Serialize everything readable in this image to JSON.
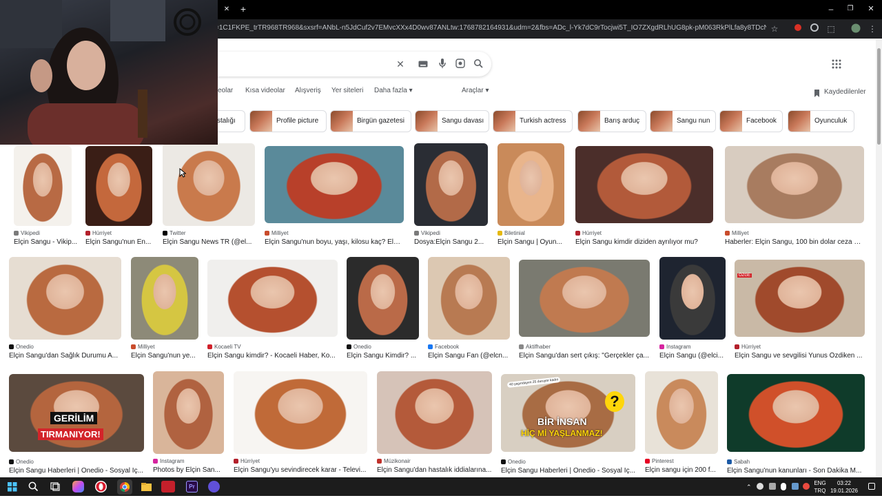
{
  "browser": {
    "close_tab_glyph": "✕",
    "new_tab_glyph": "+",
    "url": "=1C1FKPE_trTR968TR968&sxsrf=ANbL-n5JdCuf2v7EMvcXXx4D0wv87ANLtw:1768782164931&udm=2&fbs=ADc_l-Yk7dC9rTocjwi5T_IO7ZXgdRLhUG8pk-pM063RkPlLfa8y8TDcNYX0oihjHX-_g..."
  },
  "search_nav": {
    "tabs": [
      "eolar",
      "Kısa videolar",
      "Alışveriş",
      "Yer siteleri",
      "Daha fazla ▾",
      "Araçlar ▾"
    ],
    "saved_label": "Kaydedilenler"
  },
  "chips": [
    "stalığı",
    "Profile picture",
    "Birgün gazetesi",
    "Sangu davası",
    "Turkish actress",
    "Barış arduç",
    "Sangu nun",
    "Facebook",
    "Oyunculuk"
  ],
  "results": [
    {
      "source": "Vikipedi",
      "title": "Elçin Sangu - Vikip...",
      "color": "#7a7a7a"
    },
    {
      "source": "Hürriyet",
      "title": "Elçin Sangu'nun En...",
      "color": "#b3202b"
    },
    {
      "source": "Twitter",
      "title": "Elçin Sangu News TR (@el...",
      "color": "#000000"
    },
    {
      "source": "Milliyet",
      "title": "Elçin Sangu'nun boyu, yaşı, kilosu kaç? Elçi...",
      "color": "#c94c2c"
    },
    {
      "source": "Vikipedi",
      "title": "Dosya:Elçin Sangu 2...",
      "color": "#7a7a7a"
    },
    {
      "source": "Biletinial",
      "title": "Elçin Sangu | Oyun...",
      "color": "#e5b810"
    },
    {
      "source": "Hürriyet",
      "title": "Elçin Sangu kimdir diziden ayrılıyor mu?",
      "color": "#b3202b"
    },
    {
      "source": "Milliyet",
      "title": "Haberler: Elçin Sangu, 100 bin dolar ceza ve...",
      "color": "#c94c2c"
    },
    {
      "source": "Onedio",
      "title": "Elçin Sangu'dan Sağlık Durumu A...",
      "color": "#111111"
    },
    {
      "source": "Milliyet",
      "title": "Elçin Sangu'nun ye...",
      "color": "#c94c2c"
    },
    {
      "source": "Kocaeli TV",
      "title": "Elçin Sangu kimdir? - Kocaeli Haber, Ko...",
      "color": "#d0202a"
    },
    {
      "source": "Onedio",
      "title": "Elçin Sangu Kimdir? ...",
      "color": "#111111"
    },
    {
      "source": "Facebook",
      "title": "Elçin Sangu Fan (@elcn...",
      "color": "#1877f2"
    },
    {
      "source": "Aktifhaber",
      "title": "Elçin Sangu'dan sert çıkış: \"Gerçekler ça...",
      "color": "#888888"
    },
    {
      "source": "Instagram",
      "title": "Elçin Sangu (@elci...",
      "color": "#d6249f"
    },
    {
      "source": "Hürriyet",
      "title": "Elçin Sangu ve sevgilisi Yunus Özdiken ...",
      "color": "#b3202b"
    },
    {
      "source": "Onedio",
      "title": "Elçin Sangu Haberleri | Onedio - Sosyal İç...",
      "color": "#111111"
    },
    {
      "source": "Instagram",
      "title": "Photos by Elçin San...",
      "color": "#d6249f"
    },
    {
      "source": "Hürriyet",
      "title": "Elçin Sangu'yu sevindirecek karar - Televi...",
      "color": "#b3202b"
    },
    {
      "source": "Müzikonair",
      "title": "Elçin Sangu'dan hastalık iddialarına...",
      "color": "#c0302a"
    },
    {
      "source": "Onedio",
      "title": "Elçin Sangu Haberleri | Onedio - Sosyal İç...",
      "color": "#111111"
    },
    {
      "source": "Pinterest",
      "title": "Elçin sangu için 200 f...",
      "color": "#e60023"
    },
    {
      "source": "Sabah",
      "title": "Elçin Sangu'nun kanunları - Son Dakika M...",
      "color": "#1b5aa6"
    }
  ],
  "overlay_texts": {
    "gerilim": "GERİLİM",
    "tirmaniyor": "TIRMANIYOR!",
    "bir_insan": "BİR İNSAN",
    "hic_mi": "HİÇ Mİ YAŞLANMAZ!",
    "banner": "40 yaşındayım 25 duruyor kadın",
    "question": "?",
    "ozge": "ÖZGE"
  },
  "taskbar": {
    "lang_top": "ENG",
    "lang_bottom": "TRQ",
    "time": "03:22",
    "date": "19.01.2026"
  },
  "colors": {
    "chrome_bg": "#202124",
    "link_text": "#202124",
    "taskbar_bg": "#1c1c1c"
  }
}
